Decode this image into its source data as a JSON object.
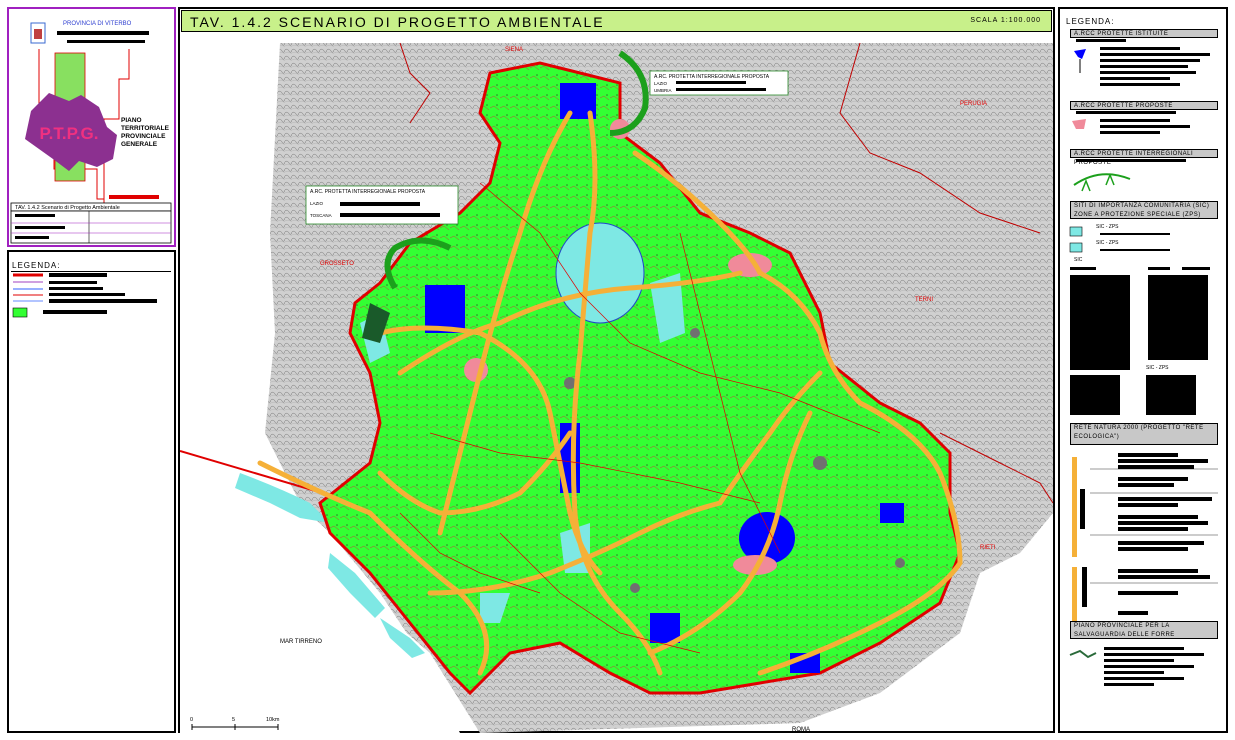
{
  "header": {
    "title": "TAV. 1.4.2 SCENARIO DI PROGETTO AMBIENTALE",
    "scale": "SCALA 1:100.000"
  },
  "title_block": {
    "province": "PROVINCIA DI VITERBO",
    "logo_text": "P.T.P.G.",
    "plan_title": "PIANO TERRITORIALE PROVINCIALE GENERALE",
    "table_label": "TAV. 1.4.2 Scenario di Progetto Ambientale"
  },
  "left_legend": {
    "title": "LEGENDA:"
  },
  "right_legend": {
    "title": "LEGENDA:",
    "sections": [
      "A.RCC PROTETTE ISTITUITE",
      "A.RCC PROTETTE PROPOSTE",
      "A.RCC PROTETTE INTERREGIONALI PROPOSTE",
      "SITI DI IMPORTANZA COMUNITARIA (SIC) ZONE A PROTEZIONE SPECIALE (ZPS)",
      "RETE NATURA 2000 (PROGETTO \"RETE ECOLOGICA\")",
      "PIANO PROVINCIALE PER LA SALVAGUARDIA DELLE FORRE"
    ],
    "sic_zps_label": "SIC - ZPS",
    "sic_label": "SIC",
    "zps_label": "ZPS",
    "sic_zps_label_2": "SIC - ZPS"
  },
  "map": {
    "places": {
      "siena": "SIENA",
      "perugia": "PERUGIA",
      "grosseto": "GROSSETO",
      "terni": "TERNI",
      "rieti": "RIETI",
      "roma": "ROMA",
      "sea": "MAR TIRRENO"
    },
    "callouts": [
      {
        "title": "A.RC. PROTETTA INTERREGIONALE PROPOSTA",
        "lines": [
          "LAZIO",
          "TOSCANA"
        ]
      },
      {
        "title": "A.RC. PROTETTA INTERREGIONALE PROPOSTA",
        "lines": [
          "LAZIO",
          "UMBRIA"
        ]
      }
    ],
    "scalebar": {
      "labels": [
        "0",
        "5",
        "10km"
      ]
    }
  },
  "colors": {
    "green": "#33ff33",
    "blue": "#0000ff",
    "cyan": "#80e8f0",
    "orange": "#f5b038",
    "pink": "#f08a9a",
    "red": "#e00000",
    "header_bg": "#c8f08a"
  }
}
